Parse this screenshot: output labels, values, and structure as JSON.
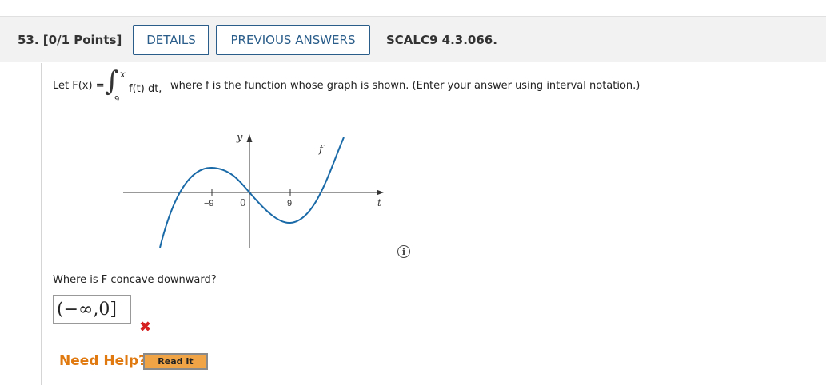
{
  "header": {
    "question_number": "53. [0/1 Points]",
    "details_label": "DETAILS",
    "previous_answers_label": "PREVIOUS ANSWERS",
    "problem_code": "SCALC9 4.3.066."
  },
  "prompt": {
    "let_text": "Let F(x) =",
    "integral_symbol": "∫",
    "upper_limit": "x",
    "lower_limit": "9",
    "integrand": "f(t) dt,",
    "description": "where f is the function whose graph is shown. (Enter your answer using interval notation.)"
  },
  "graph": {
    "y_label": "y",
    "x_label": "t",
    "function_label": "f",
    "tick_neg": "−9",
    "tick_zero": "0",
    "tick_pos": "9",
    "curve_color": "#1a6aa8"
  },
  "question": {
    "text": "Where is F concave downward?",
    "answer_value": "(−∞,0]",
    "result_icon": "x-mark-icon"
  },
  "help": {
    "need_help_label": "Need Help?",
    "read_it_label": "Read It"
  }
}
